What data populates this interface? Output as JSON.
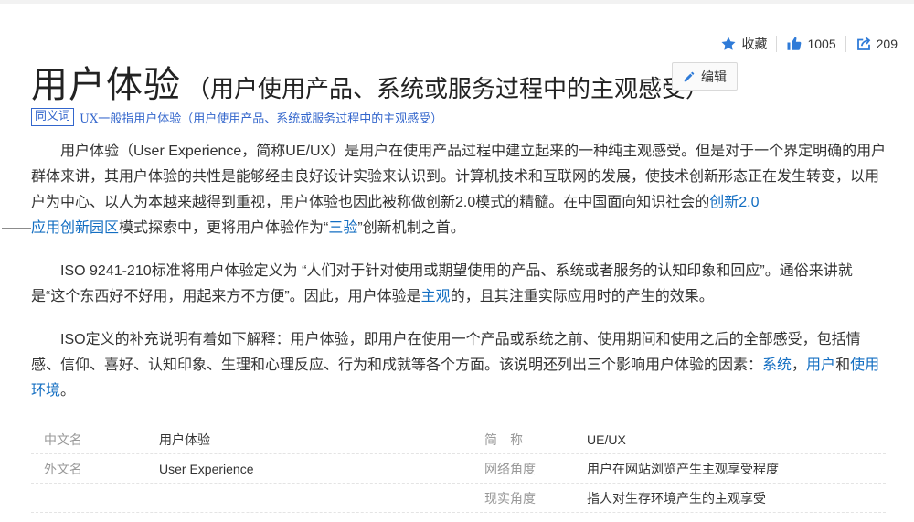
{
  "actions": {
    "collect_label": "收藏",
    "like_count": "1005",
    "share_count": "209"
  },
  "title": {
    "main": "用户体验",
    "sub": "（用户使用产品、系统或服务过程中的主观感受）",
    "edit_label": "编辑"
  },
  "synonym": {
    "tag": "同义词",
    "text": "UX一般指用户体验（用户使用产品、系统或服务过程中的主观感受）"
  },
  "paragraphs": {
    "p1": {
      "t1": "用户体验（User Experience，简称UE/UX）是用户在使用产品过程中建立起来的一种纯主观感受。但是对于一个界定明确的用户群体来讲，其用户体验的共性是能够经由良好设计实验来认识到。计算机技术和互联网的发展，使技术创新形态正在发生转变，以用户为中心、以人为本越来越得到重视，用户体验也因此被称做创新2.0模式的精髓。在中国面向知识社会的",
      "link1": "创新2.0",
      "t2": "——",
      "link2": "应用创新园区",
      "t3": "模式探索中，更将用户体验作为“",
      "link3": "三验",
      "t4": "”创新机制之首。"
    },
    "p2": {
      "t1": "ISO 9241-210标准将用户体验定义为 “人们对于针对使用或期望使用的产品、系统或者服务的认知印象和回应”。通俗来讲就是“这个东西好不好用，用起来方不方便”。因此，用户体验是",
      "link1": "主观",
      "t2": "的，且其注重实际应用时的产生的效果。"
    },
    "p3": {
      "t1": "ISO定义的补充说明有着如下解释：用户体验，即用户在使用一个产品或系统之前、使用期间和使用之后的全部感受，包括情感、信仰、喜好、认知印象、生理和心理反应、行为和成就等各个方面。该说明还列出三个影响用户体验的因素：",
      "link1": "系统",
      "t2": "，",
      "link2": "用户",
      "t3": "和",
      "link3": "使用环境",
      "t4": "。"
    }
  },
  "info": {
    "row1": {
      "k1": "中文名",
      "v1": "用户体验",
      "k2": "简　称",
      "v2": "UE/UX"
    },
    "row2": {
      "k1": "外文名",
      "v1": "User Experience",
      "k2": "网络角度",
      "v2": "用户在网站浏览产生主观享受程度"
    },
    "row3": {
      "k1": "",
      "v1": "",
      "k2": "现实角度",
      "v2": "指人对生存环境产生的主观享受"
    }
  },
  "colors": {
    "link": "#136ec2",
    "accent_icon": "#2f7bd8",
    "synonym": "#3366cc"
  }
}
